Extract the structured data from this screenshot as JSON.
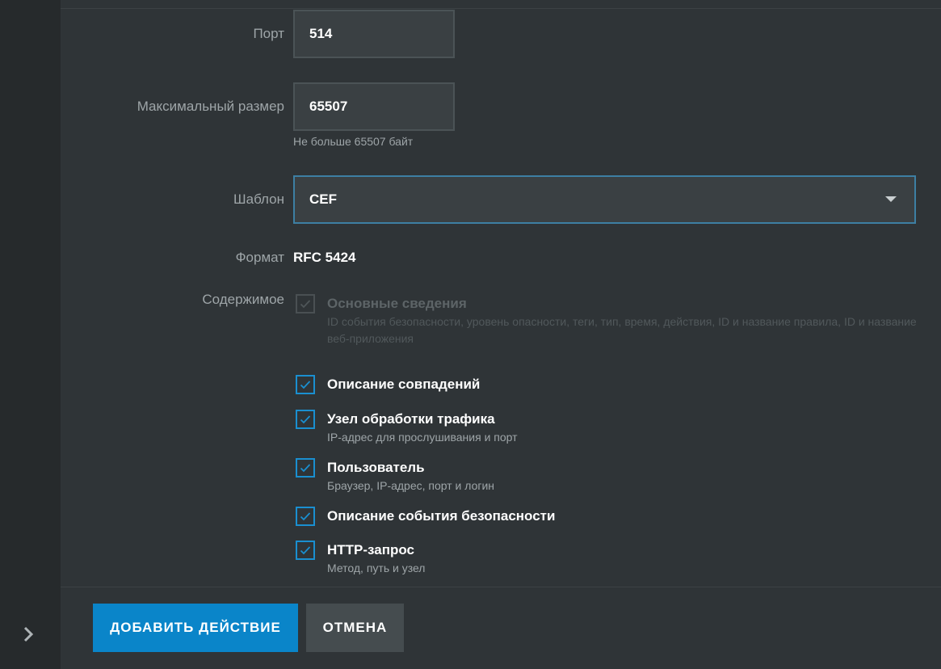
{
  "form": {
    "port": {
      "label": "Порт",
      "value": "514"
    },
    "max_size": {
      "label": "Максимальный размер",
      "value": "65507",
      "hint": "Не больше 65507 байт"
    },
    "template": {
      "label": "Шаблон",
      "value": "CEF"
    },
    "format": {
      "label": "Формат",
      "value": "RFC 5424"
    },
    "content": {
      "label": "Содержимое",
      "items": [
        {
          "title": "Основные сведения",
          "desc": "ID события безопасности, уровень опасности, теги, тип, время, действия, ID и название правила, ID и название веб-приложения",
          "checked": true,
          "disabled": true
        },
        {
          "title": "Описание совпадений",
          "desc": "",
          "checked": true,
          "disabled": false
        },
        {
          "title": "Узел обработки трафика",
          "desc": "IP-адрес для прослушивания и порт",
          "checked": true,
          "disabled": false
        },
        {
          "title": "Пользователь",
          "desc": "Браузер, IP-адрес, порт и логин",
          "checked": true,
          "disabled": false
        },
        {
          "title": "Описание события безопасности",
          "desc": "",
          "checked": true,
          "disabled": false
        },
        {
          "title": "HTTP-запрос",
          "desc": "Метод, путь и узел",
          "checked": true,
          "disabled": false
        }
      ]
    }
  },
  "footer": {
    "add_action": "ДОБАВИТЬ ДЕЙСТВИЕ",
    "cancel": "ОТМЕНА"
  },
  "icons": {
    "sidebar_expand": "chevron-right-icon",
    "dropdown": "caret-down-icon",
    "check": "checkmark-icon"
  },
  "colors": {
    "accent": "#0a85c9",
    "checkbox_border": "#1a8fd0",
    "background": "#2f3437"
  }
}
